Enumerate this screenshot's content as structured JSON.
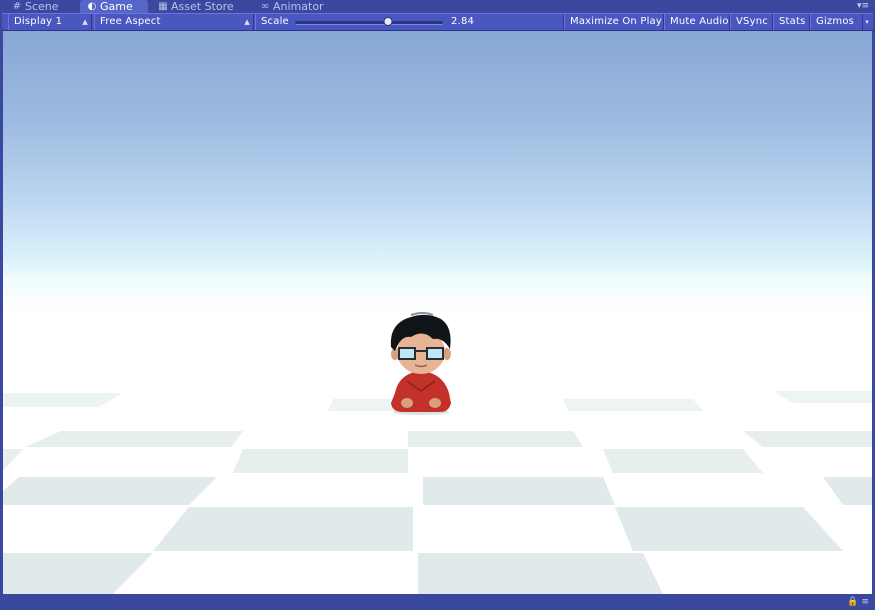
{
  "tabs": [
    {
      "label": "Scene",
      "icon": "grid-icon",
      "active": false
    },
    {
      "label": "Game",
      "icon": "pacman-icon",
      "active": true
    },
    {
      "label": "Asset Store",
      "icon": "store-icon",
      "active": false
    },
    {
      "label": "Animator",
      "icon": "animator-icon",
      "active": false
    }
  ],
  "toolbar": {
    "display_select": "Display 1",
    "aspect_select": "Free Aspect",
    "scale_label": "Scale",
    "scale_value": "2.84",
    "scale_fraction": 0.63,
    "maximize_label": "Maximize On Play",
    "mute_label": "Mute Audio",
    "vsync_label": "VSync",
    "stats_label": "Stats",
    "gizmos_label": "Gizmos"
  },
  "colors": {
    "editor_background": "#3b48a0",
    "active_tab": "#5566c8",
    "sky_top": "#87a7d4",
    "floor_shade": "#e2ebeb",
    "character_shirt": "#c2322a"
  },
  "scene": {
    "character": "chibi-boy-with-glasses"
  }
}
